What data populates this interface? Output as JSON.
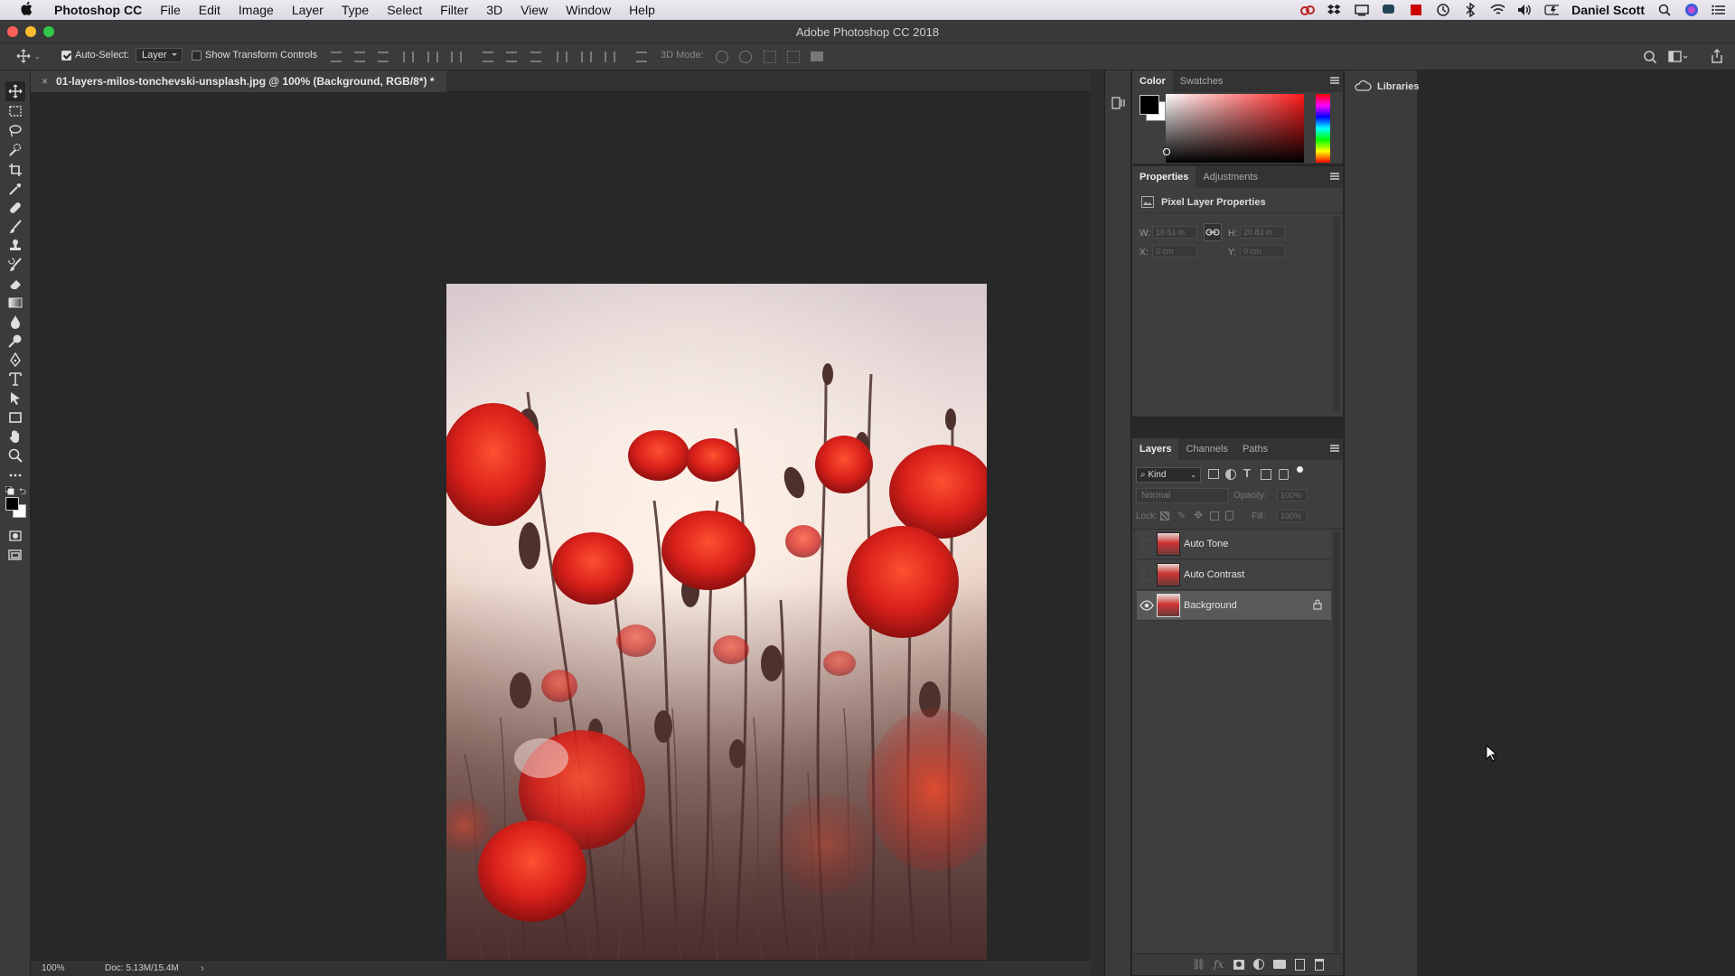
{
  "menubar": {
    "app_name": "Photoshop CC",
    "menus": [
      "File",
      "Edit",
      "Image",
      "Layer",
      "Type",
      "Select",
      "Filter",
      "3D",
      "View",
      "Window",
      "Help"
    ],
    "user": "Daniel Scott"
  },
  "window": {
    "title": "Adobe Photoshop CC 2018"
  },
  "options": {
    "auto_select_label": "Auto-Select:",
    "auto_select_checked": true,
    "auto_select_value": "Layer",
    "show_transform_label": "Show Transform Controls",
    "show_transform_checked": false,
    "mode_3d_label": "3D Mode:"
  },
  "document": {
    "tab_title": "01-layers-milos-tonchevski-unsplash.jpg @ 100% (Background, RGB/8*) *",
    "zoom": "100%",
    "doc_size": "Doc: 5.13M/15.4M"
  },
  "color_panel": {
    "tabs": [
      "Color",
      "Swatches"
    ],
    "active_tab": "Color",
    "hue_color": "#ff1a1a"
  },
  "properties_panel": {
    "tabs": [
      "Properties",
      "Adjustments"
    ],
    "section_title": "Pixel Layer Properties",
    "w_label": "W:",
    "w_value": "16.61 in",
    "h_label": "H:",
    "h_value": "20.83 in",
    "x_label": "X:",
    "x_value": "0 cm",
    "y_label": "Y:",
    "y_value": "0 cm"
  },
  "layers_panel": {
    "tabs": [
      "Layers",
      "Channels",
      "Paths"
    ],
    "filter_kind": "Kind",
    "blend_mode": "Normal",
    "opacity_label": "Opacity:",
    "opacity_value": "100%",
    "lock_label": "Lock:",
    "fill_label": "Fill:",
    "fill_value": "100%",
    "layers": [
      {
        "name": "Auto Tone",
        "visible": false,
        "selected": false,
        "locked": false
      },
      {
        "name": "Auto Contrast",
        "visible": false,
        "selected": false,
        "locked": false
      },
      {
        "name": "Background",
        "visible": true,
        "selected": true,
        "locked": true
      }
    ]
  },
  "libraries": {
    "label": "Libraries"
  },
  "colors": {
    "accent_red": "#e02020",
    "panel_bg": "#3e3e3e",
    "canvas_bg": "#282828"
  }
}
